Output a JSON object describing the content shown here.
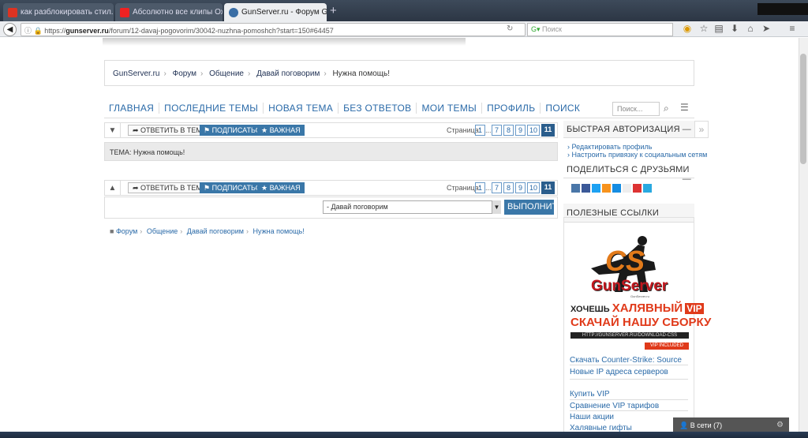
{
  "browser": {
    "tabs": [
      {
        "label": "как разблокировать стил...",
        "color": "#d32"
      },
      {
        "label": "Абсолютно все клипы Ох...",
        "color": "#e22"
      },
      {
        "label": "GunServer.ru - Форум Gun...",
        "color": "#3a6ea5"
      }
    ],
    "new_tab_label": "+",
    "url_prefix": "https://",
    "url_domain": "gunserver.ru",
    "url_rest": "/forum/12-davaj-pogovorim/30042-nuzhna-pomoshch?start=150#64457",
    "search_placeholder": "Поиск"
  },
  "breadcrumb": [
    "GunServer.ru",
    "Форум",
    "Общение",
    "Давай поговорим",
    "Нужна помощь!"
  ],
  "main_nav": [
    "Главная",
    "Последние темы",
    "Новая тема",
    "Без ответов",
    "Мои темы",
    "Профиль",
    "Поиск"
  ],
  "nav_search_placeholder": "Поиск...",
  "toolbar": {
    "reply": "Ответить в теме",
    "subscribe": "Подписаться",
    "important": "Важная",
    "page_label": "Страница:",
    "pages": [
      "1",
      "...",
      "7",
      "8",
      "9",
      "10",
      "11"
    ],
    "current_page": "11"
  },
  "topic_label": "ТЕМА: Нужна помощь!",
  "social_buttons": [
    {
      "label": "f",
      "color": "#3b5998"
    },
    {
      "label": "B",
      "color": "#4a76a8"
    },
    {
      "label": "t",
      "color": "#1da1f2"
    },
    {
      "label": "o",
      "color": "#f7931e"
    },
    {
      "label": "8+",
      "color": "#333"
    },
    {
      "label": "@",
      "color": "#168de2"
    },
    {
      "label": "in",
      "color": "#0077b5"
    },
    {
      "label": "p",
      "color": "#cb2027"
    }
  ],
  "jump": {
    "selected": "- Давай поговорим",
    "go_label": "Выполнить"
  },
  "bottom_breadcrumb": [
    "Форум",
    "Общение",
    "Давай поговорим",
    "Нужна помощь!"
  ],
  "sidebar": {
    "auth_title": "Быстрая авторизация",
    "auth_links": [
      "Редактировать профиль",
      "Настроить привязку к социальным сетям"
    ],
    "share_title": "Поделиться с друзьями",
    "useful_title": "Полезные ссылки",
    "banner": {
      "logo_cs": "CS",
      "brand": "GunServer",
      "slogan_small": "GunServer.ru",
      "line1_a": "ХОЧЕШЬ",
      "line1_b": "ХАЛЯВНЫЙ",
      "line1_c": "VIP",
      "line2": "СКАЧАЙ НАШУ СБОРКУ",
      "url_strip": "HTTP://GUNSERVER.RU/DOWNLOAD-CSS",
      "vip_badge": "VIP INCLUDED"
    },
    "links_a": [
      "Скачать Counter-Strike: Source",
      "Новые IP адреса серверов"
    ],
    "links_b": [
      "Купить VIP",
      "Сравнение VIP тарифов",
      "Наши акции",
      "Халявные гифты"
    ]
  },
  "online_widget": "В сети (7)"
}
